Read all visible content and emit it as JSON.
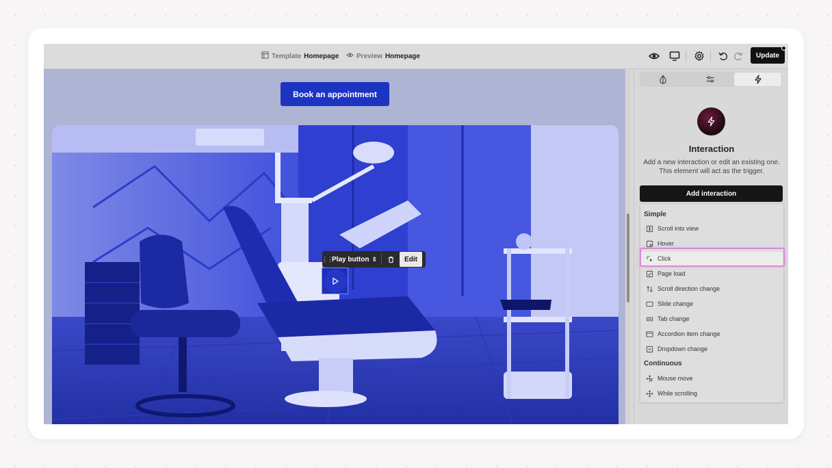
{
  "topbar": {
    "template_label": "Template",
    "template_page": "Homepage",
    "preview_label": "Preview",
    "preview_page": "Homepage",
    "update_label": "Update"
  },
  "canvas": {
    "book_button": "Book an appointment",
    "element_toolbar": {
      "element_name": "Play button",
      "edit_label": "Edit"
    }
  },
  "panel": {
    "title": "Interaction",
    "description_line1": "Add a new interaction or edit an existing one.",
    "description_line2": "This element will act as the trigger.",
    "add_button": "Add interaction",
    "sections": [
      {
        "label": "Simple",
        "items": [
          {
            "label": "Scroll into view",
            "icon": "scroll-into-view-icon"
          },
          {
            "label": "Hover",
            "icon": "hover-icon"
          },
          {
            "label": "Click",
            "icon": "click-icon"
          },
          {
            "label": "Page load",
            "icon": "page-load-icon"
          },
          {
            "label": "Scroll direction change",
            "icon": "scroll-direction-icon"
          },
          {
            "label": "Slide change",
            "icon": "slide-change-icon"
          },
          {
            "label": "Tab change",
            "icon": "tab-change-icon"
          },
          {
            "label": "Accordion item change",
            "icon": "accordion-icon"
          },
          {
            "label": "Dropdown change",
            "icon": "dropdown-icon"
          }
        ]
      },
      {
        "label": "Continuous",
        "items": [
          {
            "label": "Mouse move",
            "icon": "mouse-move-icon"
          },
          {
            "label": "While scrolling",
            "icon": "while-scrolling-icon"
          }
        ]
      }
    ]
  },
  "colors": {
    "accent_blue": "#1d34c2",
    "highlight_pink": "#d88ad6",
    "dark": "#111111"
  }
}
